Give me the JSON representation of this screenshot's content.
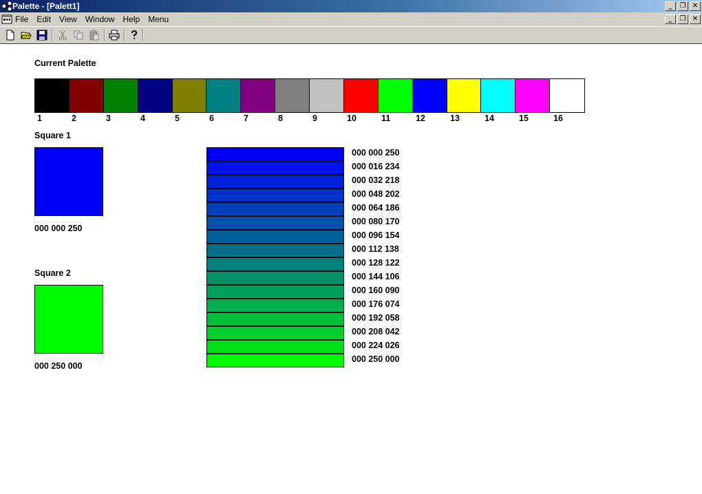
{
  "window": {
    "title": "Palette - [Palett1]"
  },
  "menu": {
    "items": [
      "File",
      "Edit",
      "View",
      "Window",
      "Help",
      "Menu"
    ]
  },
  "toolbar": {
    "icons": [
      "new-icon",
      "open-icon",
      "save-icon",
      "cut-icon",
      "copy-icon",
      "paste-icon",
      "print-icon",
      "help-icon"
    ]
  },
  "palette": {
    "label": "Current Palette",
    "colors": [
      "#000000",
      "#800000",
      "#008000",
      "#000080",
      "#808000",
      "#008080",
      "#800080",
      "#808080",
      "#c0c0c0",
      "#ff0000",
      "#00ff00",
      "#0000ff",
      "#ffff00",
      "#00ffff",
      "#ff00ff",
      "#ffffff"
    ],
    "numbers": [
      "1",
      "2",
      "3",
      "4",
      "5",
      "6",
      "7",
      "8",
      "9",
      "10",
      "11",
      "12",
      "13",
      "14",
      "15",
      "16"
    ]
  },
  "square1": {
    "label": "Square 1",
    "color": "#0000fa",
    "value": "000 000 250"
  },
  "square2": {
    "label": "Square 2",
    "color": "#00fa00",
    "value": "000 250 000"
  },
  "gradient": {
    "steps": [
      {
        "color": "#0000fa",
        "value": "000 000 250"
      },
      {
        "color": "#0010ea",
        "value": "000 016 234"
      },
      {
        "color": "#0020da",
        "value": "000 032 218"
      },
      {
        "color": "#0030ca",
        "value": "000 048 202"
      },
      {
        "color": "#0040ba",
        "value": "000 064 186"
      },
      {
        "color": "#0050aa",
        "value": "000 080 170"
      },
      {
        "color": "#00609a",
        "value": "000 096 154"
      },
      {
        "color": "#00708a",
        "value": "000 112 138"
      },
      {
        "color": "#00807a",
        "value": "000 128 122"
      },
      {
        "color": "#00906a",
        "value": "000 144 106"
      },
      {
        "color": "#00a05a",
        "value": "000 160 090"
      },
      {
        "color": "#00b04a",
        "value": "000 176 074"
      },
      {
        "color": "#00c03a",
        "value": "000 192 058"
      },
      {
        "color": "#00d02a",
        "value": "000 208 042"
      },
      {
        "color": "#00e01a",
        "value": "000 224 026"
      },
      {
        "color": "#00fa00",
        "value": "000 250 000"
      }
    ]
  }
}
